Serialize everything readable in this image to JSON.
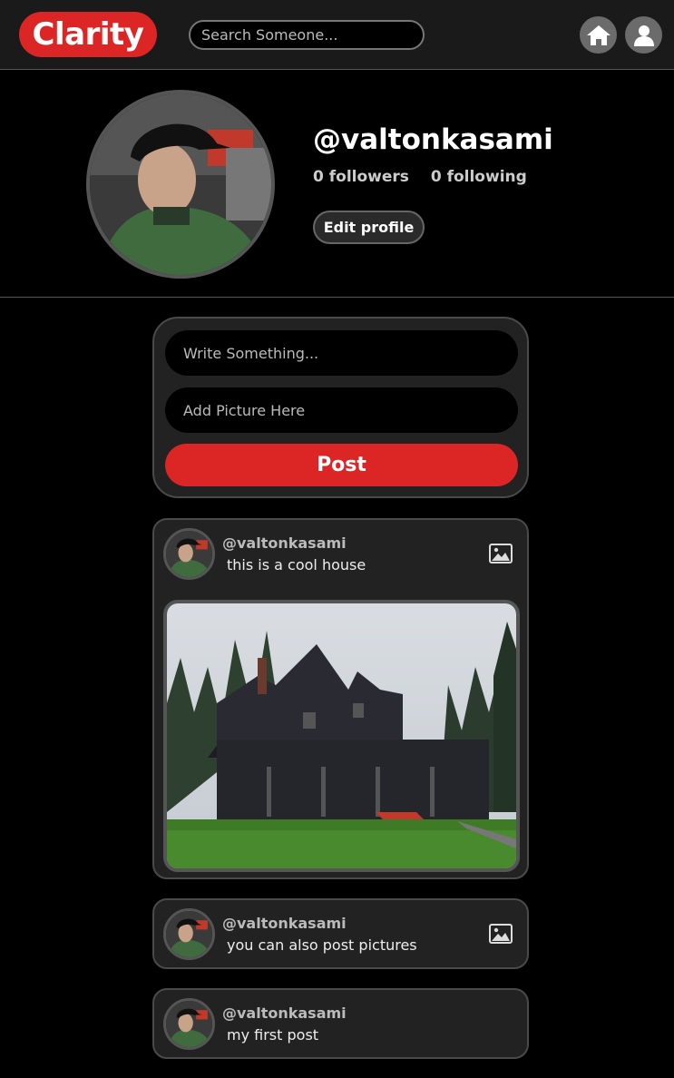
{
  "app": {
    "logo": "Clarity",
    "search_placeholder": "Search Someone..."
  },
  "nav": {
    "home_icon": "home-icon",
    "user_icon": "user-icon"
  },
  "profile": {
    "username": "@valtonkasami",
    "followers": "0 followers",
    "following": "0 following",
    "edit_label": "Edit profile"
  },
  "composer": {
    "text_placeholder": "Write Something...",
    "picture_placeholder": "Add Picture Here",
    "post_label": "Post"
  },
  "posts": [
    {
      "user": "@valtonkasami",
      "text": "this is a cool house",
      "has_image": true
    },
    {
      "user": "@valtonkasami",
      "text": "you can also post pictures",
      "has_image": true
    },
    {
      "user": "@valtonkasami",
      "text": "my first post",
      "has_image": false
    }
  ],
  "colors": {
    "brand_red": "#dc2626",
    "card_bg": "#222222",
    "page_bg": "#000000"
  }
}
